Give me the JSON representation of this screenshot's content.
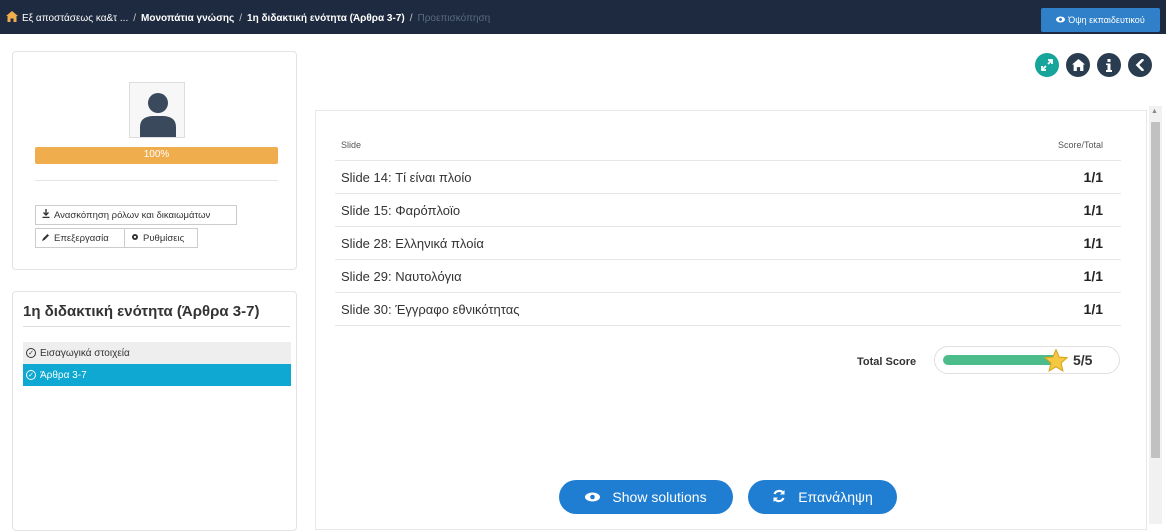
{
  "colors": {
    "topbar": "#1e2a3f",
    "teacher_button": "#2f80c8",
    "progress": "#f0ad4e",
    "active_item": "#0ea8d2",
    "action_button": "#1f7ed2",
    "score_bar": "#4cbc8a",
    "round_teal": "#17a49a",
    "round_dark": "#2a3d50"
  },
  "breadcrumb": {
    "items": [
      "Εξ αποστάσεως κα&τ ...",
      "Μονοπάτια γνώσης",
      "1η διδακτική ενότητα (Άρθρα 3-7)",
      "Προεπισκόπηση"
    ],
    "separator": "/"
  },
  "header": {
    "teacher_view_label": "Όψη εκπαιδευτικού"
  },
  "round_buttons": {
    "fullscreen_icon": "expand-icon",
    "home_icon": "home-icon",
    "info_icon": "info-icon",
    "back_icon": "chevron-left-icon"
  },
  "profile": {
    "progress_percent": 100,
    "progress_label": "100%",
    "roles_button": "Ανασκόπηση ρόλων και δικαιωμάτων",
    "edit_button": "Επεξεργασία",
    "settings_button": "Ρυθμίσεις"
  },
  "module": {
    "title": "1η διδακτική ενότητα (Άρθρα 3-7)",
    "items": [
      {
        "label": "Εισαγωγικά στοιχεία",
        "active": false
      },
      {
        "label": "Άρθρα 3-7",
        "active": true
      }
    ]
  },
  "results": {
    "column_slide": "Slide",
    "column_score": "Score/Total",
    "rows": [
      {
        "slide": "Slide 14: Τί είναι πλοίο",
        "score": "1/1"
      },
      {
        "slide": "Slide 15: Φαρόπλοϊο",
        "score": "1/1"
      },
      {
        "slide": "Slide 28: Ελληνικά πλοία",
        "score": "1/1"
      },
      {
        "slide": "Slide 29: Ναυτολόγια",
        "score": "1/1"
      },
      {
        "slide": "Slide 30: Έγγραφο εθνικότητας",
        "score": "1/1"
      }
    ],
    "total_label": "Total Score",
    "total_value": "5/5",
    "total_fraction": 1.0
  },
  "actions": {
    "show_solutions": "Show solutions",
    "retry": "Επανάληψη"
  }
}
